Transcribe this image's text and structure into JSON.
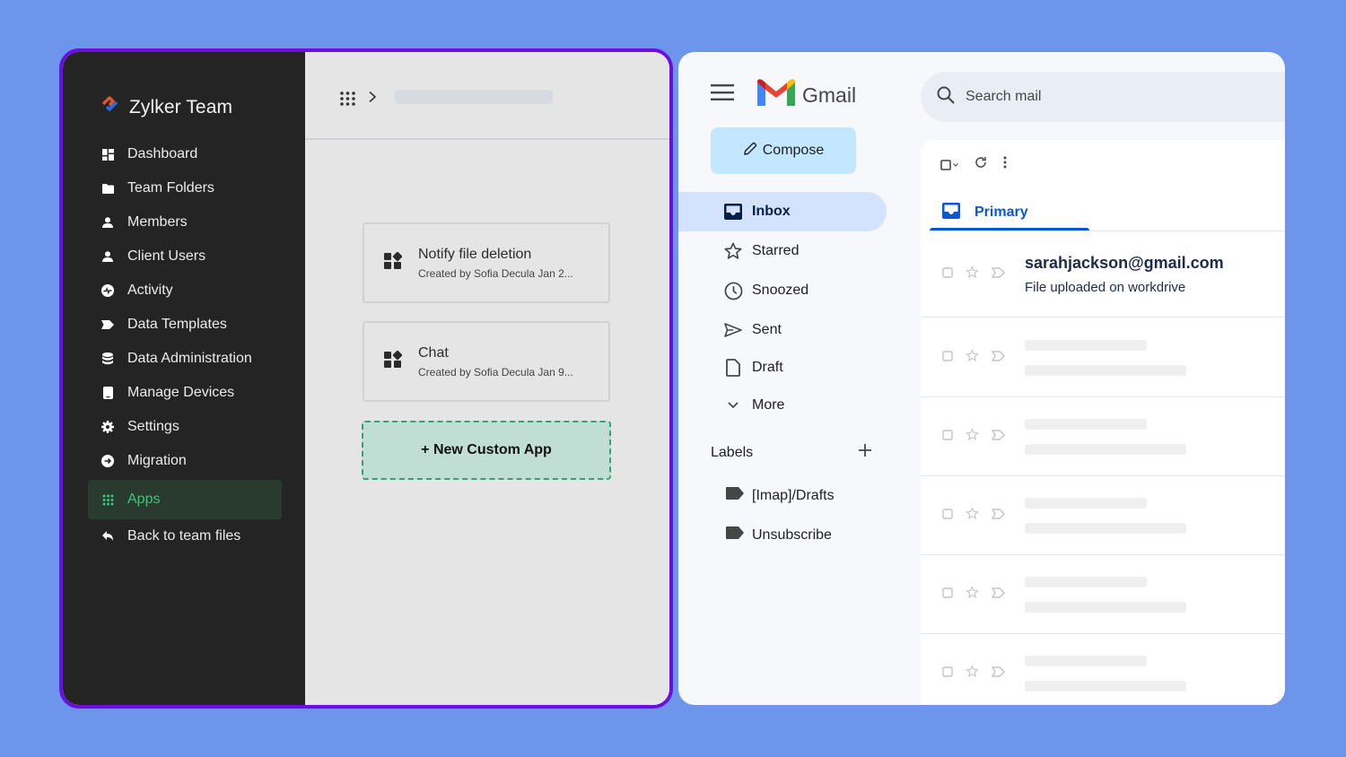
{
  "workdrive": {
    "brand": "Zylker Team",
    "nav": [
      {
        "label": "Dashboard",
        "icon": "dashboard-icon"
      },
      {
        "label": "Team Folders",
        "icon": "folder-icon"
      },
      {
        "label": "Members",
        "icon": "person-icon"
      },
      {
        "label": "Client Users",
        "icon": "person-icon"
      },
      {
        "label": "Activity",
        "icon": "activity-icon"
      },
      {
        "label": "Data Templates",
        "icon": "tag-icon"
      },
      {
        "label": "Data Administration",
        "icon": "database-icon"
      },
      {
        "label": "Manage Devices",
        "icon": "device-icon"
      },
      {
        "label": "Settings",
        "icon": "gear-icon"
      },
      {
        "label": "Migration",
        "icon": "migration-icon"
      },
      {
        "label": "Apps",
        "icon": "apps-grid-icon",
        "active": true
      },
      {
        "label": "Back to team files",
        "icon": "back-arrow-icon"
      }
    ],
    "colors": {
      "accent": "#3fc47d",
      "frame": "#6a0ee3",
      "sidebar": "#242424"
    },
    "apps": [
      {
        "title": "Notify file deletion",
        "subtitle": "Created by Sofia Decula Jan 2..."
      },
      {
        "title": "Chat",
        "subtitle": "Created by Sofia Decula Jan 9..."
      }
    ],
    "new_app_label": "+ New Custom App"
  },
  "gmail": {
    "logo_text": "Gmail",
    "search_placeholder": "Search mail",
    "compose_label": "Compose",
    "nav": [
      {
        "label": "Inbox",
        "icon": "inbox-icon",
        "active": true
      },
      {
        "label": "Starred",
        "icon": "star-icon"
      },
      {
        "label": "Snoozed",
        "icon": "clock-icon"
      },
      {
        "label": "Sent",
        "icon": "send-icon"
      },
      {
        "label": "Draft",
        "icon": "draft-icon"
      },
      {
        "label": "More",
        "icon": "chevron-down-icon"
      }
    ],
    "labels_heading": "Labels",
    "labels": [
      "[Imap]/Drafts",
      "Unsubscribe"
    ],
    "tab_primary": "Primary",
    "emails": [
      {
        "sender": "sarahjackson@gmail.com",
        "subject": "File uploaded on workdrive"
      }
    ],
    "colors": {
      "accent": "#0b57d0",
      "compose_bg": "#c2e7ff",
      "inbox_active": "#d3e3fd"
    }
  }
}
